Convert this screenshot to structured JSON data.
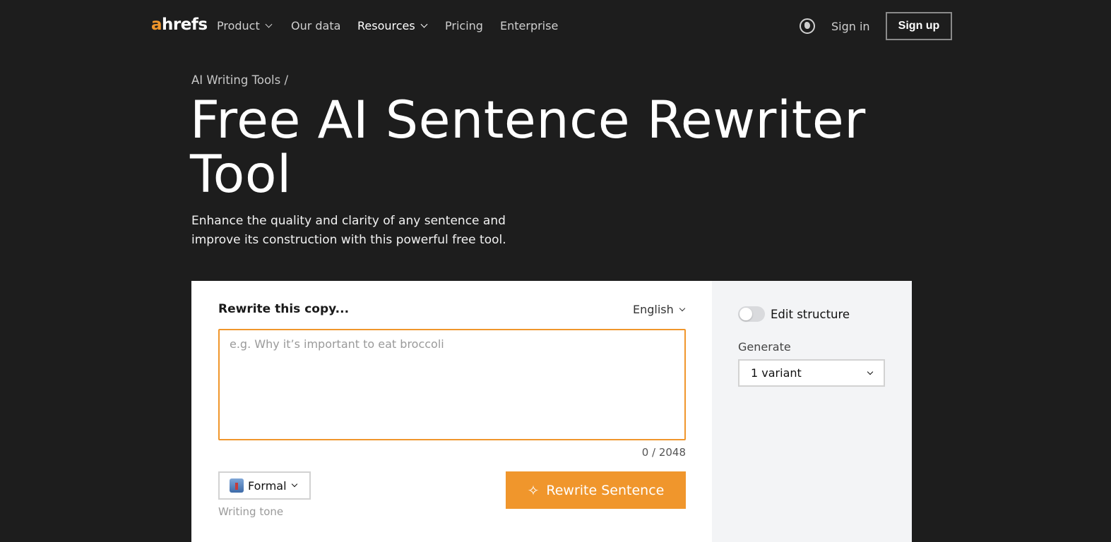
{
  "nav": {
    "logo_a": "a",
    "logo_rest": "hrefs",
    "items": [
      {
        "label": "Product"
      },
      {
        "label": "Our data"
      },
      {
        "label": "Resources"
      },
      {
        "label": "Pricing"
      },
      {
        "label": "Enterprise"
      }
    ],
    "sign_in": "Sign in",
    "sign_up": "Sign up"
  },
  "hero": {
    "breadcrumb": "AI Writing Tools /",
    "title": "Free AI Sentence Rewriter Tool",
    "subtitle": "Enhance the quality and clarity of any sentence and improve its construction with this powerful free tool."
  },
  "tool": {
    "input_label": "Rewrite this copy...",
    "language": "English",
    "input_value": "",
    "input_placeholder": "e.g. Why it’s important to eat broccoli",
    "char_count": "0 / 2048",
    "tone_value": "Formal",
    "tone_label": "Writing tone",
    "submit_label": "Rewrite Sentence"
  },
  "options": {
    "edit_structure_label": "Edit structure",
    "edit_structure_on": false,
    "generate_label": "Generate",
    "generate_value": "1 variant"
  },
  "colors": {
    "accent": "#f0962c",
    "background": "#1d1d1d",
    "panel": "#f3f4f6"
  }
}
